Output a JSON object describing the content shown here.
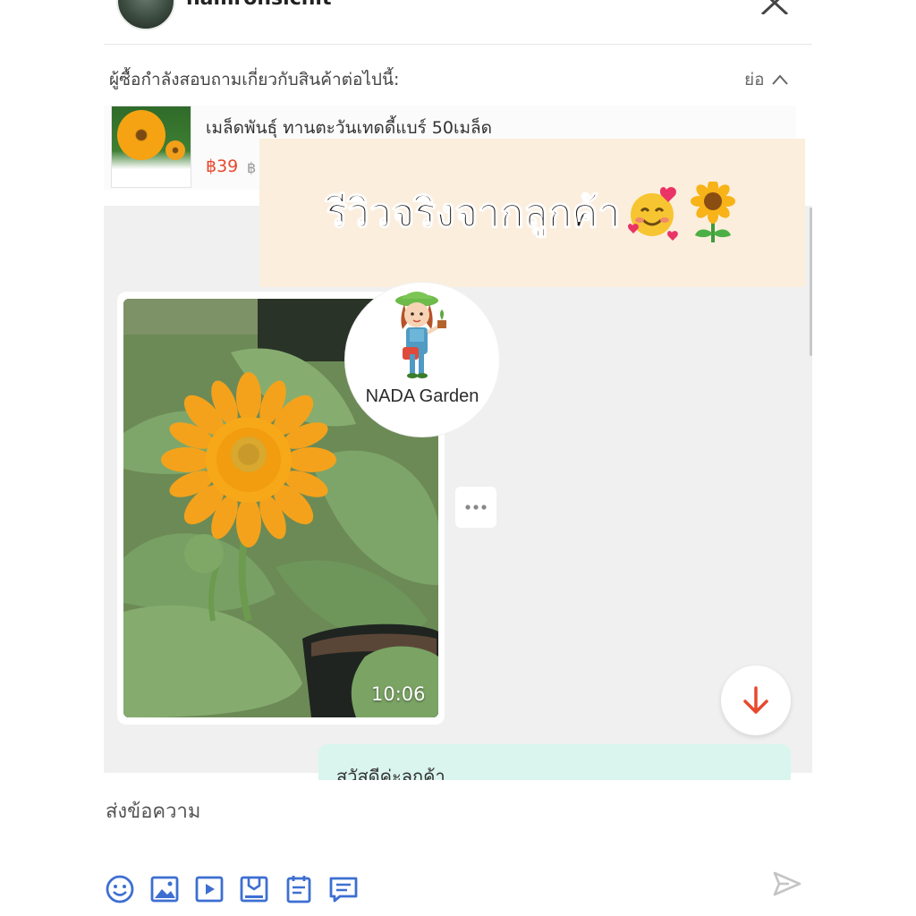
{
  "header": {
    "username": "namronsichit",
    "avatar_icon": "avatar",
    "close_icon": "close-icon"
  },
  "inquiry": {
    "text": "ผู้ซื้อกำลังสอบถามเกี่ยวกับสินค้าต่อไปนี้:",
    "collapse_label": "ย่อ"
  },
  "product": {
    "name": "เมล็ดพันธุ์ ทานตะวันเทดดี้แบร์ 50เมล็ด",
    "price": "฿39",
    "old_price": "฿"
  },
  "overlay": {
    "review_text": "รีวิวจริงจากลูกค้า",
    "logo_text": "NADA Garden"
  },
  "chat": {
    "photo_time": "10:06",
    "seller_message": "สวัสดีค่ะลูกค้า"
  },
  "composer": {
    "placeholder": "ส่งข้อความ",
    "tools": [
      "emoji-icon",
      "image-icon",
      "video-icon",
      "product-icon",
      "order-icon",
      "voucher-icon"
    ],
    "send_icon": "send-icon"
  },
  "colors": {
    "price": "#e8492d",
    "seller_bubble": "#d9f5ee",
    "banner_bg": "#fbeedd",
    "scroll_arrow": "#e8492d"
  }
}
